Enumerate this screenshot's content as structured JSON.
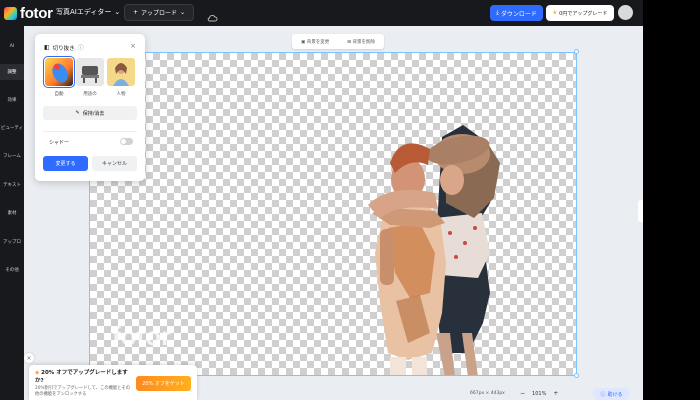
{
  "topbar": {
    "logo_text": "fotor",
    "editor_label": "写真AIエディター",
    "upload_label": "アップロード",
    "download_label": "ダウンロード",
    "trial_label": "0円でアップグレード"
  },
  "nav": {
    "items": [
      {
        "label": "AI"
      },
      {
        "label": "調整"
      },
      {
        "label": "効果"
      },
      {
        "label": "ビューティ"
      },
      {
        "label": "フレーム"
      },
      {
        "label": "テキスト"
      },
      {
        "label": "素材"
      },
      {
        "label": "アップロ"
      },
      {
        "label": "その他"
      }
    ],
    "active_index": 1
  },
  "canvas_toolbar": {
    "bg_label": "背景を変更",
    "cutout_label": "背景を削除"
  },
  "watermark": "fotor",
  "panel": {
    "title": "切り抜き",
    "close": "×",
    "thumbs": [
      {
        "label": "自動"
      },
      {
        "label": "用途の"
      },
      {
        "label": "人物"
      }
    ],
    "keep_erase_label": "保持/消去",
    "shadow_label": "シャドー",
    "apply_label": "変更する",
    "cancel_label": "キャンセル"
  },
  "promo": {
    "title": "20% オフでアップグレードしますか?",
    "desc": "20%割引でアップグレードして、この機能とその他の機能をアンロックする",
    "button_label": "20% オフをゲット",
    "close": "×"
  },
  "bottom": {
    "dimensions": "667px × 443px",
    "zoom_minus": "−",
    "zoom_value": "101%",
    "zoom_plus": "+",
    "help_label": "助ける"
  },
  "colors": {
    "accent": "#2f6bff",
    "topbar_bg": "#18191c",
    "canvas_bg": "#eaedf1",
    "promo_orange": "#ff8a1f",
    "selection": "#7cc4ff"
  }
}
